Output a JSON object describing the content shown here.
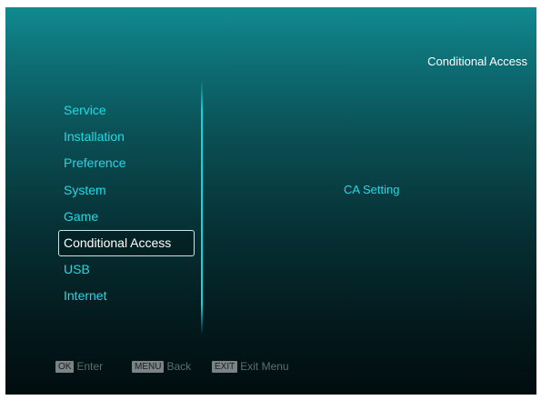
{
  "header": {
    "title": "Conditional Access"
  },
  "menu": {
    "items": [
      {
        "label": "Service"
      },
      {
        "label": "Installation"
      },
      {
        "label": "Preference"
      },
      {
        "label": "System"
      },
      {
        "label": "Game"
      },
      {
        "label": "Conditional Access",
        "selected": true
      },
      {
        "label": "USB"
      },
      {
        "label": "Internet"
      }
    ]
  },
  "submenu": {
    "items": [
      {
        "label": "CA Setting"
      }
    ]
  },
  "footer": {
    "ok": {
      "key": "OK",
      "label": "Enter"
    },
    "menu": {
      "key": "MENU",
      "label": "Back"
    },
    "exit": {
      "key": "EXIT",
      "label": "Exit Menu"
    }
  },
  "colors": {
    "accent": "#22d9e6",
    "selected_text": "#ffffff",
    "hint_text": "#5a6f70"
  }
}
